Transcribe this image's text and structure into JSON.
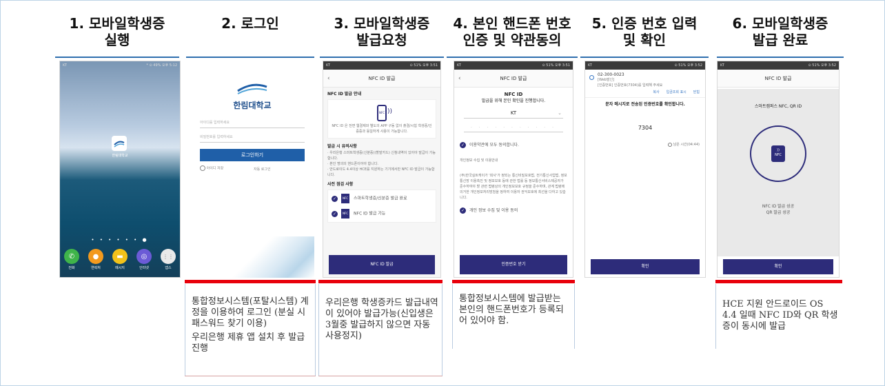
{
  "steps": [
    {
      "title_line1": "1. 모바일학생증",
      "title_line2": "실행"
    },
    {
      "title_line1": "2. 로그인",
      "title_line2": ""
    },
    {
      "title_line1": "3. 모바일학생증",
      "title_line2": "발급요청"
    },
    {
      "title_line1": "4. 본인 핸드폰 번호",
      "title_line2": "인증 및 약관동의"
    },
    {
      "title_line1": "5. 인증 번호 입력",
      "title_line2": "및 확인"
    },
    {
      "title_line1": "6. 모바일학생증",
      "title_line2": "발급 완료"
    }
  ],
  "phone1": {
    "status_left": "KT",
    "status_right": "* ⊙ 49% 오후 5:12",
    "app_label": "한림대학교",
    "dock": [
      {
        "label": "전화",
        "icon": "phone-icon",
        "color": "#3fb44a",
        "glyph": "✆"
      },
      {
        "label": "연락처",
        "icon": "contacts-icon",
        "color": "#f39a1e",
        "glyph": "●"
      },
      {
        "label": "메시지",
        "icon": "message-icon",
        "color": "#f2c21a",
        "glyph": "▬"
      },
      {
        "label": "인터넷",
        "icon": "internet-icon",
        "color": "#6b5bd6",
        "glyph": "◎"
      },
      {
        "label": "앱스",
        "icon": "apps-icon",
        "color": "#e9e9e9",
        "glyph": "⋮⋮"
      }
    ]
  },
  "phone2": {
    "university": "한림대학교",
    "id_placeholder": "아이디를 입력하세요",
    "pw_placeholder": "비밀번호를 입력하세요",
    "login_button": "로그인하기",
    "save_id": "아이디 저장",
    "auto_login": "자동 로그인"
  },
  "phone3": {
    "status": "KT",
    "title": "NFC ID 발급",
    "section1": "NFC ID 발급 안내",
    "guide": "NFC ID 은 전면 웹결제와 별도의 APP 구동 없이 출결/시험 학생증/인증증과 동일하게 사용이 가능합니다.",
    "section2": "발급 시 유의사항",
    "notes": "· 우리은행 스마트학생증(신분증)(할발카드) 신청내역이 있어야 발급이 가능합니다.\n· 본인 명의의 핸드폰이어야 합니다.\n· 안드로이드 4.4이상 HCE를 지원하는 기기에서만 NFC ID 발급이 가능합니다.",
    "section3": "사전 점검 사항",
    "check1": "스마트학생증/신분증 발급 완료",
    "check2": "NFC ID 발급 가능",
    "button": "NFC ID 발급"
  },
  "phone4": {
    "status": "KT",
    "title": "NFC ID 발급",
    "heading1": "NFC ID",
    "heading2": "발급을 위해 본인 확인을 진행합니다.",
    "carrier": "KT",
    "agree_all": "이용약관에 모두 동의합니다.",
    "terms_title": "개인정보 수집 및 이용안내",
    "terms_body": "(주)한국실트캐이가 '회사'가 정되는 통신비밀보호법, 전기통신사업법, 정보통신망 이용촉진 및 정보보호 등에 관한 법률 등 정보통신서비스제공자가 준수하여야 할 관련 법령상의 개인정보보호 규정을 준수하며, 관계 법령에 의거한 개인정보처리방침을 정하여 이용자 권익보호에 최선을 다하고 있습니다.",
    "agree_personal": "개인 정보 수집 및 이용 동의",
    "button": "인증번호 받기"
  },
  "phone5": {
    "status": "KT",
    "sms_number": "02-300-0023",
    "sms_tag": "[Web발신]",
    "sms_body": "[인증번호] 인증번호(7304)를 입력해 주세요",
    "links": [
      "복사",
      "입금조회 표시",
      "닫힘"
    ],
    "prompt": "문자 메시지로 전송된 인증번호를 확인합니다.",
    "code": "7304",
    "timer": "남은 시간(04:44)",
    "button": "확인"
  },
  "phone6": {
    "status": "KT",
    "title": "NFC ID 발급",
    "subtitle": "스마트캠퍼스 NFC, QR ID",
    "badge": "NFC",
    "result1": "NFC ID 발급 성공",
    "result2": "QR 발급 성공",
    "button": "확인"
  },
  "notes": {
    "col2": [
      "통합정보시스템(포탈시스템) 계정을 이용하여 로그인 (분실 시 패스워드 찾기 이용)",
      "우리은행 제휴 앱 설치 후 발급진행"
    ],
    "col3": [
      "우리은행 학생증카드 발급내역이 있어야 발급가능(신입생은 3월중 발급하지 않으면 자동 사용정지)"
    ],
    "col4": [
      "통합정보시스템에 발급받는 본인의 핸드폰번호가 등록되어 있어야 함."
    ],
    "col6": [
      "HCE 지원 안드로이드 OS 4.4 일때 NFC ID와 QR 학생증이 동시에 발급"
    ]
  }
}
